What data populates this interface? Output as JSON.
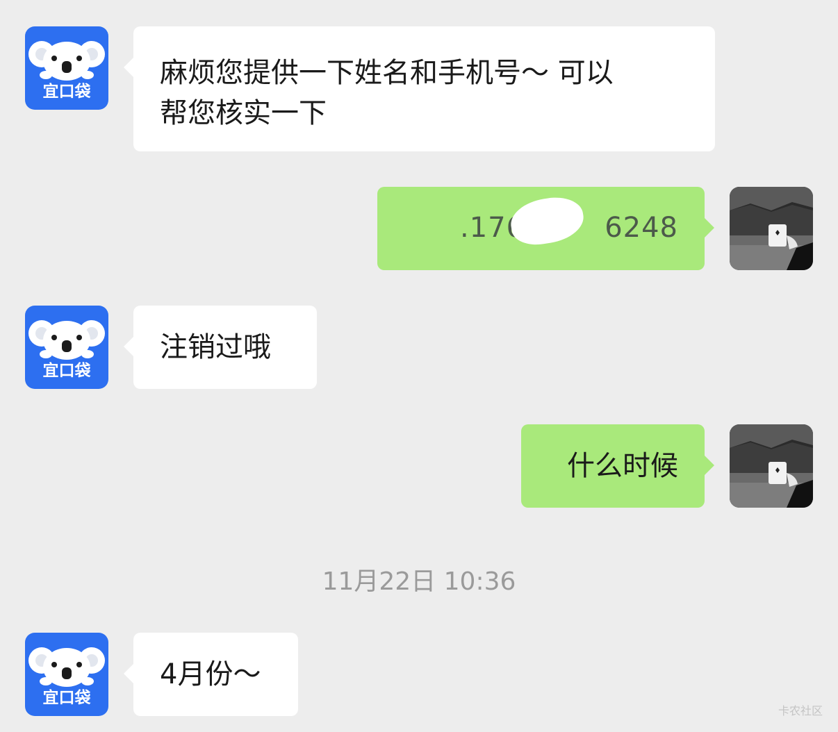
{
  "colors": {
    "background": "#ededed",
    "incoming_bubble": "#ffffff",
    "outgoing_bubble": "#a9e97b",
    "brand_blue": "#2d6ff0",
    "timestamp_text": "#9a9a9a"
  },
  "contact": {
    "avatar_icon": "koala-logo-icon",
    "avatar_text": "宜口袋"
  },
  "user": {
    "avatar_icon": "user-photo-icon"
  },
  "messages": [
    {
      "from": "contact",
      "line1": "麻烦您提供一下姓名和手机号～ 可以",
      "line2": "帮您核实一下"
    },
    {
      "from": "user",
      "text_start": ".176",
      "text_end": "6248"
    },
    {
      "from": "contact",
      "text": "注销过哦"
    },
    {
      "from": "user",
      "text": "什么时候"
    },
    {
      "from": "contact",
      "text": "4月份～"
    }
  ],
  "timestamp": "11月22日 10:36",
  "watermark": "卡农社区"
}
